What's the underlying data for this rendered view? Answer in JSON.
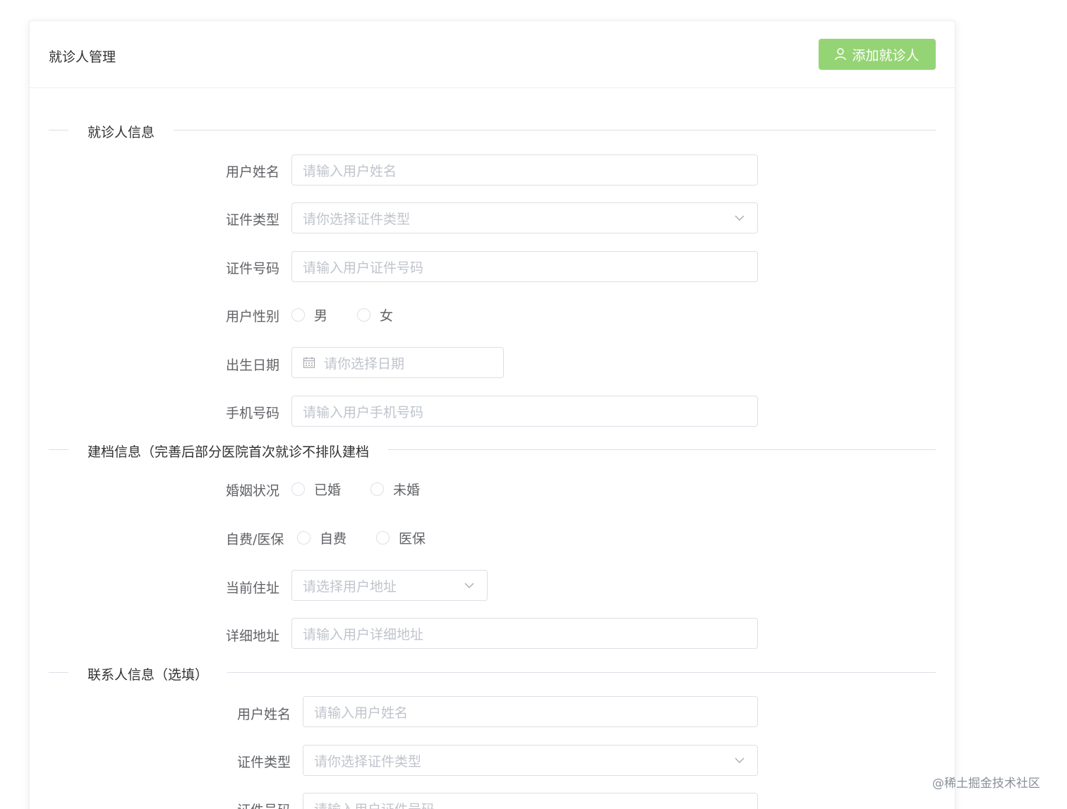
{
  "header": {
    "title": "就诊人管理",
    "add_button": "添加就诊人"
  },
  "sections": {
    "patient_info": "就诊人信息",
    "archive_info": "建档信息（完善后部分医院首次就诊不排队建档",
    "contact_info": "联系人信息（选填）"
  },
  "patient": {
    "name_label": "用户姓名",
    "name_placeholder": "请输入用户姓名",
    "cert_type_label": "证件类型",
    "cert_type_placeholder": "请你选择证件类型",
    "cert_no_label": "证件号码",
    "cert_no_placeholder": "请输入用户证件号码",
    "gender_label": "用户性别",
    "gender_options": [
      "男",
      "女"
    ],
    "birth_label": "出生日期",
    "birth_placeholder": "请你选择日期",
    "phone_label": "手机号码",
    "phone_placeholder": "请输入用户手机号码"
  },
  "archive": {
    "marital_label": "婚姻状况",
    "marital_options": [
      "已婚",
      "未婚"
    ],
    "payment_label": "自费/医保",
    "payment_options": [
      "自费",
      "医保"
    ],
    "address_label": "当前住址",
    "address_placeholder": "请选择用户地址",
    "detail_label": "详细地址",
    "detail_placeholder": "请输入用户详细地址"
  },
  "contact": {
    "name_label": "用户姓名",
    "name_placeholder": "请输入用户姓名",
    "cert_type_label": "证件类型",
    "cert_type_placeholder": "请你选择证件类型",
    "cert_no_label": "证件号码",
    "cert_no_placeholder": "请输入用户证件号码"
  },
  "watermark": "@稀土掘金技术社区",
  "colors": {
    "success_light": "#95d475",
    "border": "#dcdfe6",
    "placeholder": "#c0c4cc",
    "label": "#606266"
  }
}
